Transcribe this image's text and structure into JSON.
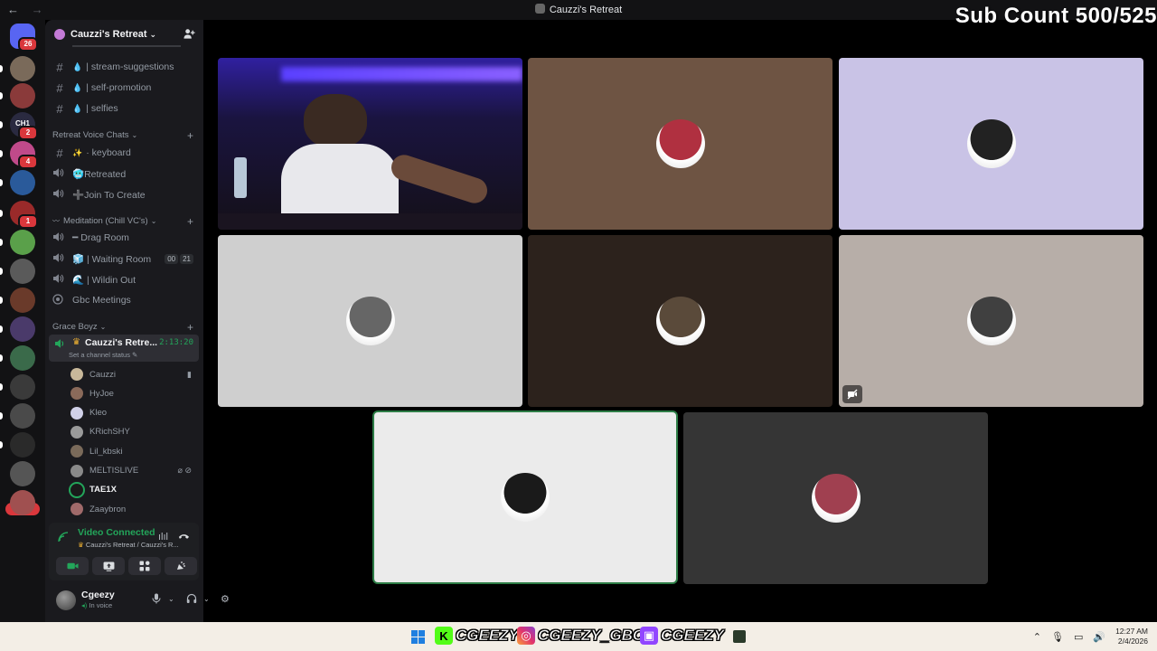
{
  "window": {
    "title": "Cauzzi's Retreat",
    "back": "←",
    "forward": "→"
  },
  "overlay_text": "Sub Count 500/525",
  "servers": [
    {
      "color": "#5865f2",
      "badge": "26"
    },
    {
      "color": "#7a6a5a",
      "badge": ""
    },
    {
      "color": "#8a3a3a",
      "badge": ""
    },
    {
      "color": "#2a2a40",
      "badge": "2",
      "label": "CH1"
    },
    {
      "color": "#c04a8a",
      "badge": "4"
    },
    {
      "color": "#2a5a9a",
      "badge": ""
    },
    {
      "color": "#9a2a2a",
      "badge": "1"
    },
    {
      "color": "#5aa04a",
      "badge": ""
    },
    {
      "color": "#5a5a5a",
      "badge": ""
    },
    {
      "color": "#6a3a2a",
      "badge": ""
    },
    {
      "color": "#4a3a6a",
      "badge": ""
    },
    {
      "color": "#3a6a4a",
      "badge": ""
    },
    {
      "color": "#3a3a3a",
      "badge": ""
    },
    {
      "color": "#4a4a4a",
      "badge": ""
    },
    {
      "color": "#2a2a2a",
      "badge": ""
    },
    {
      "color": "#555555",
      "badge": ""
    },
    {
      "color": "#a05050",
      "badge": ""
    }
  ],
  "new_badge": "NEW",
  "guild": {
    "name": "Cauzzi's Retreat",
    "chevron": "⌄"
  },
  "text_channels": [
    {
      "emoji": "💧",
      "name": "| stream-suggestions"
    },
    {
      "emoji": "💧",
      "name": "| self-promotion"
    },
    {
      "emoji": "💧",
      "name": "| selfies"
    }
  ],
  "categories": {
    "retreat_voice": "Retreat Voice Chats",
    "meditation": "Meditation (Chill VC's)",
    "grace_boyz": "Grace Boyz"
  },
  "retreat_channels": [
    {
      "emoji": "✨",
      "name": "· keyboard",
      "icon": "#"
    },
    {
      "emoji": "",
      "name": "🥶Retreated",
      "icon": "speaker"
    },
    {
      "emoji": "",
      "name": "➕Join To Create",
      "icon": "speaker"
    }
  ],
  "meditation_channels": [
    {
      "name": "━ Drag Room",
      "icon": "speaker",
      "counts": []
    },
    {
      "name": "🧊 | Waiting Room",
      "icon": "speaker",
      "counts": [
        "00",
        "21"
      ]
    },
    {
      "name": "🌊 | Wildin Out",
      "icon": "speaker",
      "counts": []
    },
    {
      "name": "Gbc Meetings",
      "icon": "stage",
      "counts": []
    }
  ],
  "active_channel": {
    "name": "Cauzzi's Retre...",
    "timer": "2:13:20",
    "status": "Set a channel status ✎"
  },
  "members": [
    {
      "name": "Cauzzi",
      "color": "#c8b89a",
      "icon": "▮",
      "speaking": false,
      "bold": false
    },
    {
      "name": "HyJoe",
      "color": "#8a6a5a",
      "icon": "",
      "speaking": false,
      "bold": false
    },
    {
      "name": "Kleo",
      "color": "#d0d0e8",
      "icon": "",
      "speaking": false,
      "bold": false
    },
    {
      "name": "KRichSHY",
      "color": "#9a9a9a",
      "icon": "",
      "speaking": false,
      "bold": false
    },
    {
      "name": "Lil_kbski",
      "color": "#7a6a5a",
      "icon": "",
      "speaking": false,
      "bold": false
    },
    {
      "name": "MELTISLIVE",
      "color": "#8a8a8a",
      "icon": "⌀ ⊘",
      "speaking": false,
      "bold": false
    },
    {
      "name": "TAE1X",
      "color": "#1a1a1a",
      "icon": "",
      "speaking": true,
      "bold": true
    },
    {
      "name": "Zaaybron",
      "color": "#a06a6a",
      "icon": "",
      "speaking": false,
      "bold": false
    }
  ],
  "voice": {
    "status": "Video Connected",
    "sub": "Cauzzi's Retreat / Cauzzi's R..."
  },
  "user": {
    "name": "Cgeezy",
    "status": "In voice"
  },
  "tiles": [
    {
      "bg": "#1b1a4a",
      "avatar": "",
      "kind": "video"
    },
    {
      "bg": "#6e5443",
      "avatar": "#b03040"
    },
    {
      "bg": "#c9c3e6",
      "avatar": "#222222"
    },
    {
      "bg": "#cfcfcf",
      "avatar": "#666666"
    },
    {
      "bg": "#2c221c",
      "avatar": "#5a4a3a"
    },
    {
      "bg": "#b7aea8",
      "avatar": "#404040",
      "cam_off": true
    },
    {
      "bg": "#ebebeb",
      "avatar": "#1a1a1a",
      "active": true
    },
    {
      "bg": "#353535",
      "avatar": "#a04050"
    }
  ],
  "taskbar": {
    "kick": "CGEEZY",
    "instagram": "CGEEZY_GBC",
    "twitch": "CGEEZY",
    "time": "12:27 AM",
    "date": "2/4/2026"
  }
}
